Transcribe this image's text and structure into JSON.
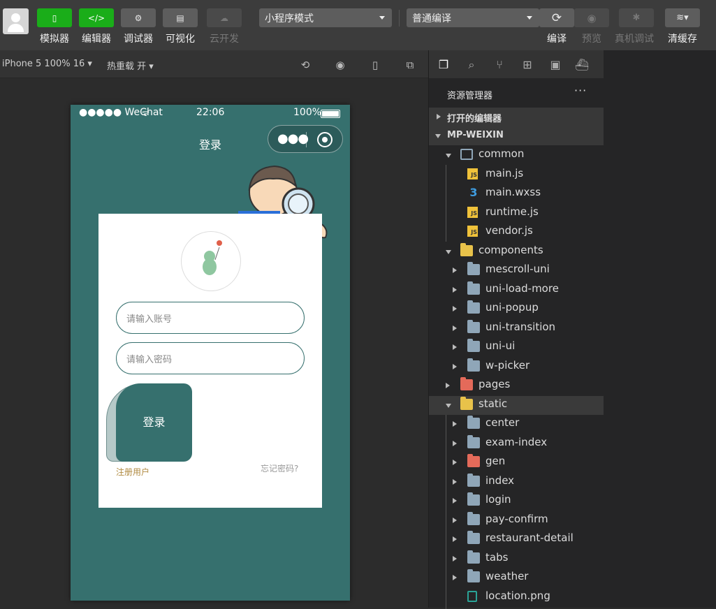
{
  "toolbar": {
    "tools": [
      {
        "label": "模拟器",
        "glyph": "▯"
      },
      {
        "label": "编辑器",
        "glyph": "</>"
      },
      {
        "label": "调试器",
        "glyph": "⚙"
      },
      {
        "label": "可视化",
        "glyph": "▤"
      },
      {
        "label": "云开发",
        "glyph": "☁"
      }
    ],
    "mode_select": "小程序模式",
    "compile_select": "普通编译",
    "actions": [
      {
        "label": "编译"
      },
      {
        "label": "预览"
      },
      {
        "label": "真机调试"
      },
      {
        "label": "清缓存"
      }
    ]
  },
  "subbar": {
    "device": "iPhone 5 100% 16",
    "hot_reload": "热重载 开"
  },
  "phone": {
    "carrier": "●●●●● WeChat",
    "time": "22:06",
    "battery": "100%",
    "nav_title": "登录",
    "account_placeholder": "请输入账号",
    "password_placeholder": "请输入密码",
    "login_button": "登录",
    "register_link": "注册用户",
    "forgot_link": "忘记密码?"
  },
  "explorer": {
    "title": "资源管理器",
    "open_editors": "打开的编辑器",
    "project": "MP-WEIXIN",
    "items": [
      {
        "label": "common",
        "type": "folder-open"
      },
      {
        "label": "main.js",
        "type": "js"
      },
      {
        "label": "main.wxss",
        "type": "css"
      },
      {
        "label": "runtime.js",
        "type": "js"
      },
      {
        "label": "vendor.js",
        "type": "js"
      },
      {
        "label": "components",
        "type": "folder-yellow-open"
      },
      {
        "label": "mescroll-uni",
        "type": "folder"
      },
      {
        "label": "uni-load-more",
        "type": "folder"
      },
      {
        "label": "uni-popup",
        "type": "folder"
      },
      {
        "label": "uni-transition",
        "type": "folder"
      },
      {
        "label": "uni-ui",
        "type": "folder"
      },
      {
        "label": "w-picker",
        "type": "folder"
      },
      {
        "label": "pages",
        "type": "folder-red"
      },
      {
        "label": "static",
        "type": "folder-yellow-open"
      },
      {
        "label": "center",
        "type": "folder"
      },
      {
        "label": "exam-index",
        "type": "folder"
      },
      {
        "label": "gen",
        "type": "folder-red"
      },
      {
        "label": "index",
        "type": "folder"
      },
      {
        "label": "login",
        "type": "folder"
      },
      {
        "label": "pay-confirm",
        "type": "folder"
      },
      {
        "label": "restaurant-detail",
        "type": "folder"
      },
      {
        "label": "tabs",
        "type": "folder"
      },
      {
        "label": "weather",
        "type": "folder"
      },
      {
        "label": "location.png",
        "type": "png"
      }
    ]
  }
}
